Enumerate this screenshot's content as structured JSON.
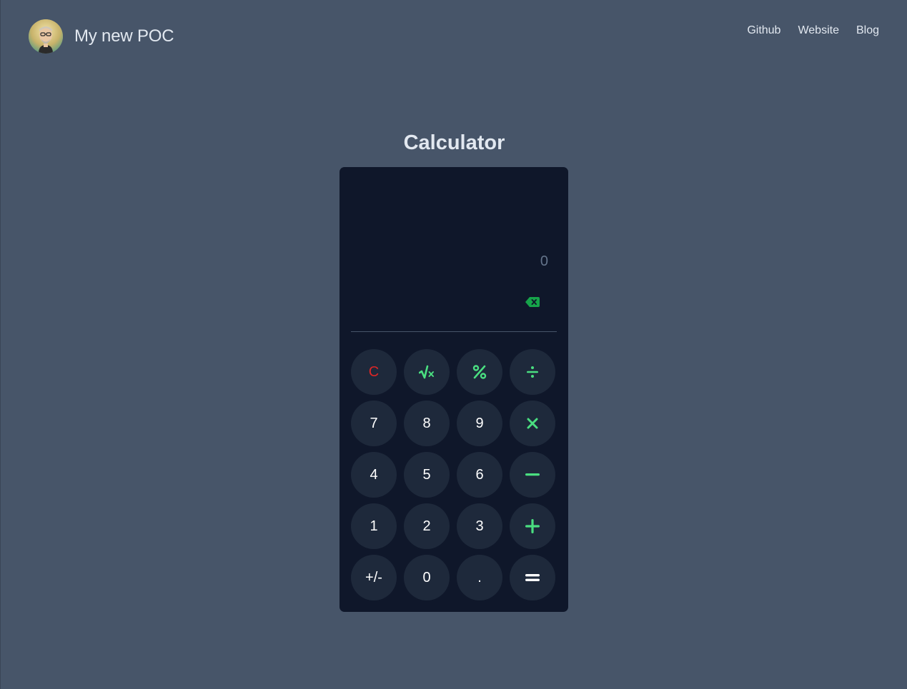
{
  "header": {
    "brand_title": "My new POC",
    "nav": [
      "Github",
      "Website",
      "Blog"
    ]
  },
  "calculator": {
    "title": "Calculator",
    "display_value": "0",
    "keys": [
      {
        "label": "C",
        "name": "clear-button",
        "color": "#dc2626"
      },
      {
        "label": "√x",
        "name": "square-root-button",
        "icon": "square-root-icon",
        "color": "#4ade80"
      },
      {
        "label": "%",
        "name": "percent-button",
        "color": "#4ade80"
      },
      {
        "label": "÷",
        "name": "divide-button",
        "icon": "divide-icon",
        "color": "#4ade80"
      },
      {
        "label": "7",
        "name": "digit-7-button"
      },
      {
        "label": "8",
        "name": "digit-8-button"
      },
      {
        "label": "9",
        "name": "digit-9-button"
      },
      {
        "label": "×",
        "name": "multiply-button",
        "icon": "multiply-icon",
        "color": "#4ade80"
      },
      {
        "label": "4",
        "name": "digit-4-button"
      },
      {
        "label": "5",
        "name": "digit-5-button"
      },
      {
        "label": "6",
        "name": "digit-6-button"
      },
      {
        "label": "−",
        "name": "subtract-button",
        "icon": "minus-icon",
        "color": "#4ade80"
      },
      {
        "label": "1",
        "name": "digit-1-button"
      },
      {
        "label": "2",
        "name": "digit-2-button"
      },
      {
        "label": "3",
        "name": "digit-3-button"
      },
      {
        "label": "+",
        "name": "add-button",
        "icon": "plus-icon",
        "color": "#4ade80"
      },
      {
        "label": "+/-",
        "name": "negate-button"
      },
      {
        "label": "0",
        "name": "digit-0-button"
      },
      {
        "label": ".",
        "name": "decimal-button"
      },
      {
        "label": "=",
        "name": "equals-button",
        "icon": "equals-icon"
      }
    ]
  },
  "colors": {
    "background": "#475569",
    "panel": "#0f172a",
    "key": "#1e293b",
    "accent_green": "#4ade80",
    "accent_red": "#dc2626",
    "backspace_green": "#16a34a"
  },
  "icons": {
    "avatar": "memoji-avatar",
    "backspace": "backspace-icon"
  }
}
